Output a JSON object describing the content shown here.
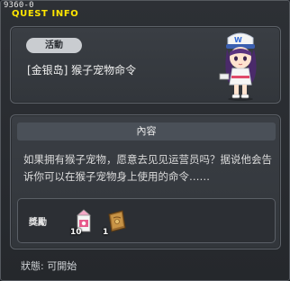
{
  "quest": {
    "id": "9360-0",
    "window_title": "QUEST INFO",
    "category": "活動",
    "name": "[金银岛] 猴子宠物命令",
    "content_header": "內容",
    "description": "如果拥有猴子宠物，愿意去见见运营员吗？据说他会告诉你可以在猴子宠物身上使用的命令……",
    "reward_label": "獎勵",
    "rewards": [
      {
        "icon": "milk-carton-icon",
        "count": "10"
      },
      {
        "icon": "brown-book-icon",
        "count": "1"
      }
    ],
    "status": "狀態:  可開始"
  },
  "colors": {
    "title": "#ffe600",
    "background": "#2d3035",
    "panel": "#3a3e44"
  }
}
